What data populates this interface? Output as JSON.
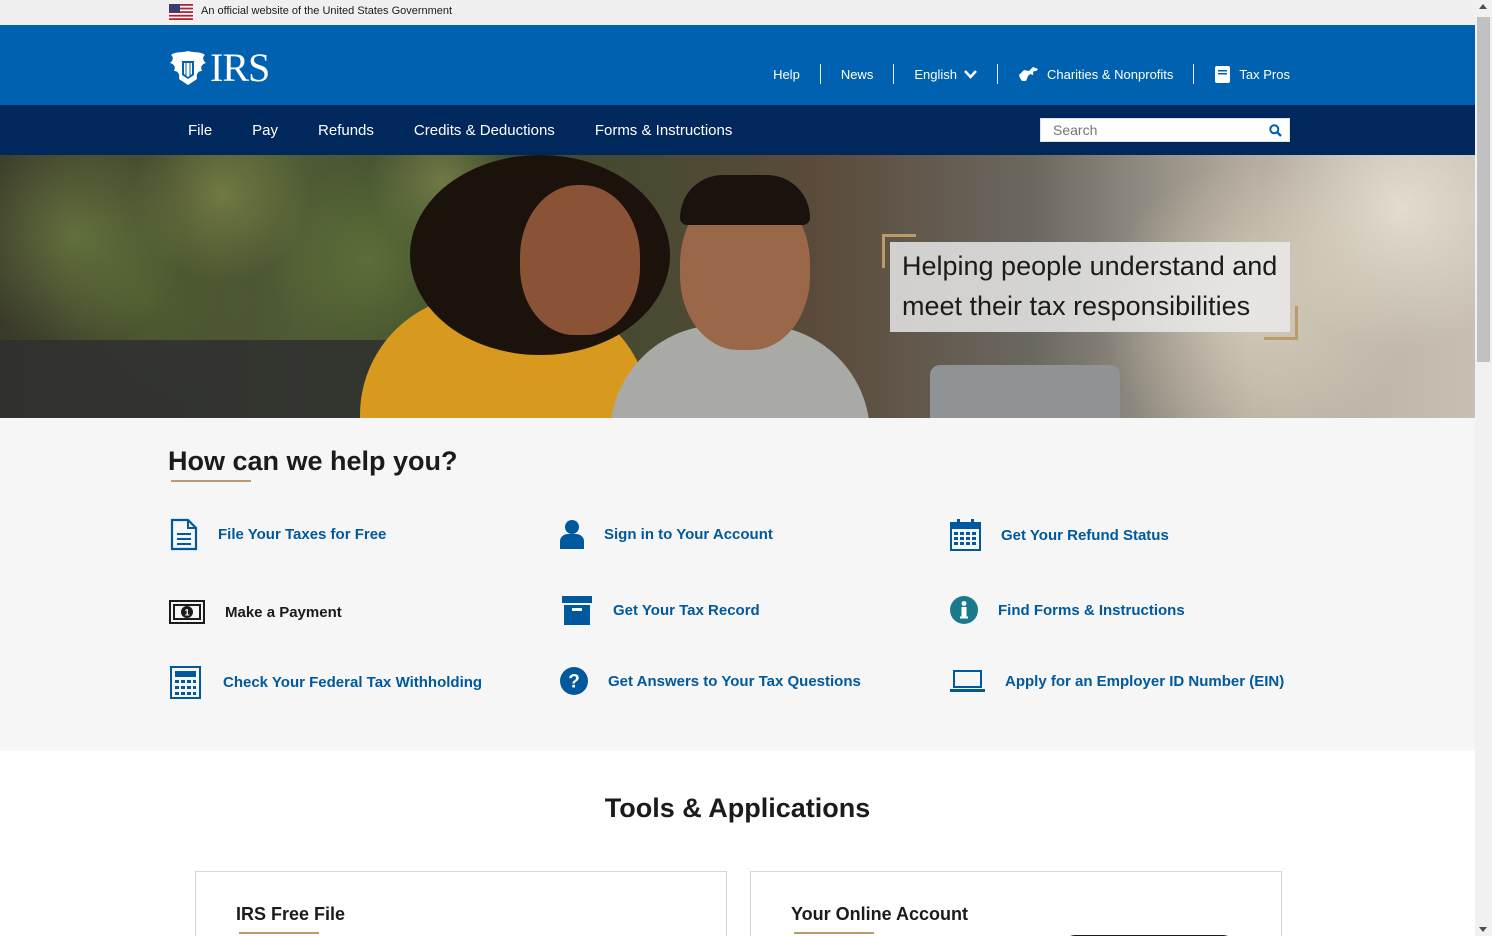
{
  "gov_banner": {
    "text": "An official website of the United States Government"
  },
  "header": {
    "logo_text": "IRS",
    "util_nav": {
      "help": "Help",
      "news": "News",
      "language": "English",
      "charities": "Charities & Nonprofits",
      "taxpros": "Tax Pros"
    }
  },
  "main_nav": {
    "items": [
      "File",
      "Pay",
      "Refunds",
      "Credits & Deductions",
      "Forms & Instructions"
    ],
    "search_placeholder": "Search"
  },
  "hero": {
    "tagline": "Helping people understand and meet their tax responsibilities"
  },
  "help": {
    "title": "How can we help you?",
    "links": [
      {
        "label": "File Your Taxes for Free",
        "icon": "document-icon"
      },
      {
        "label": "Sign in to Your Account",
        "icon": "user-icon"
      },
      {
        "label": "Get Your Refund Status",
        "icon": "calendar-icon"
      },
      {
        "label": "Make a Payment",
        "icon": "money-icon"
      },
      {
        "label": "Get Your Tax Record",
        "icon": "archive-box-icon"
      },
      {
        "label": "Find Forms & Instructions",
        "icon": "info-icon"
      },
      {
        "label": "Check Your Federal Tax Withholding",
        "icon": "calculator-icon"
      },
      {
        "label": "Get Answers to Your Tax Questions",
        "icon": "question-icon"
      },
      {
        "label": "Apply for an Employer ID Number (EIN)",
        "icon": "laptop-icon"
      }
    ]
  },
  "tools": {
    "title": "Tools & Applications",
    "cards": [
      {
        "title": "IRS Free File"
      },
      {
        "title": "Your Online Account"
      }
    ]
  },
  "colors": {
    "header_blue": "#0061b0",
    "nav_navy": "#00285c",
    "link_blue": "#00599c",
    "accent_gold": "#bc9b6a",
    "icon_teal": "#1a7a8c"
  }
}
